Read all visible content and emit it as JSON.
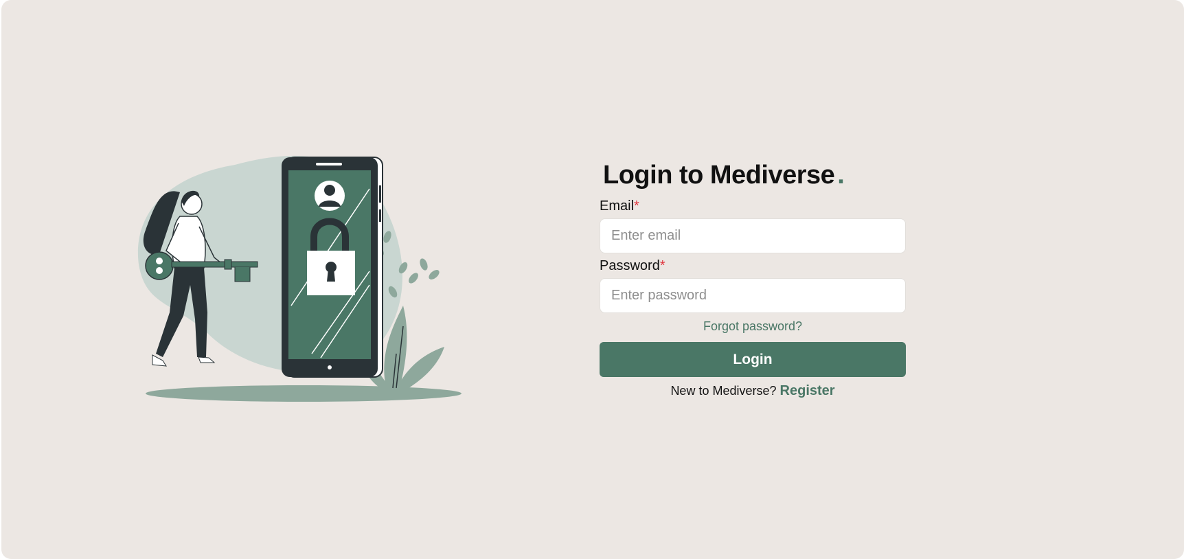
{
  "login": {
    "title": "Login to Mediverse",
    "title_dot": ".",
    "email": {
      "label": "Email",
      "required_mark": "*",
      "placeholder": "Enter email",
      "value": ""
    },
    "password": {
      "label": "Password",
      "required_mark": "*",
      "placeholder": "Enter password",
      "value": ""
    },
    "forgot_label": "Forgot password?",
    "submit_label": "Login",
    "register_prompt": "New to Mediverse?",
    "register_label": "Register"
  },
  "illustration": {
    "icon": "person-with-key-unlocking-phone-illustration"
  },
  "colors": {
    "background": "#ece7e3",
    "accent": "#4a7766",
    "required": "#e0323b",
    "blob": "#c9d6d1",
    "phone_dark": "#2a3337"
  }
}
